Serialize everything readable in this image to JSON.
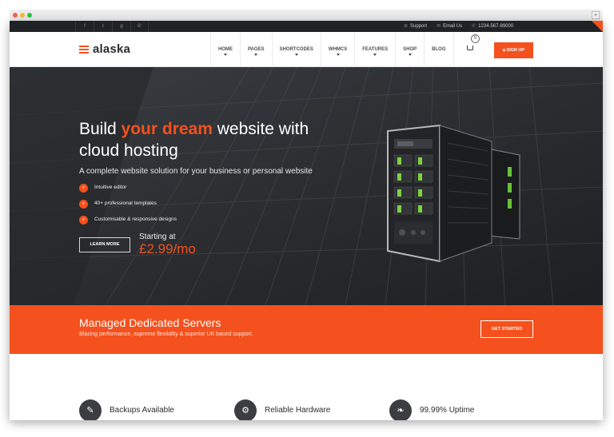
{
  "browser": {
    "new_tab_label": "+"
  },
  "topbar": {
    "social": [
      "f",
      "t",
      "g",
      "✆"
    ],
    "links": [
      {
        "icon": "support-icon",
        "glyph": "⊕",
        "label": "Support"
      },
      {
        "icon": "email-icon",
        "glyph": "✉",
        "label": "Email Us"
      },
      {
        "icon": "phone-icon",
        "glyph": "✆",
        "label": "1234-567-89000"
      }
    ]
  },
  "header": {
    "logo": "alaska",
    "nav": [
      "HOME",
      "PAGES",
      "SHORTCODES",
      "WHMCS",
      "FEATURES",
      "SHOP",
      "BLOG"
    ],
    "nav_has_dropdown": [
      true,
      true,
      true,
      true,
      true,
      true,
      false
    ],
    "cart_count": "0",
    "signup_label": "SIGN UP"
  },
  "hero": {
    "title_pre": "Build ",
    "title_accent": "your dream",
    "title_post": " website with cloud hosting",
    "subtitle": "A complete website solution for your business or personal website",
    "features": [
      "Intuitive editor",
      "40+ professional templates",
      "Customisable & responsive designs"
    ],
    "learn_more": "LEARN MORE",
    "price_label": "Starting at",
    "price": "£2.99/mo"
  },
  "banner": {
    "title": "Managed Dedicated Servers",
    "subtitle": "Blazing performance, supreme flexibility & superior UK based support.",
    "cta": "GET STARTED"
  },
  "bottom_features": [
    {
      "icon": "wrench-icon",
      "glyph": "✎",
      "label": "Backups Available"
    },
    {
      "icon": "hardware-icon",
      "glyph": "⚙",
      "label": "Reliable Hardware"
    },
    {
      "icon": "leaf-icon",
      "glyph": "❧",
      "label": "99.99% Uptime"
    }
  ],
  "colors": {
    "accent": "#f4511e",
    "dark": "#202226"
  }
}
